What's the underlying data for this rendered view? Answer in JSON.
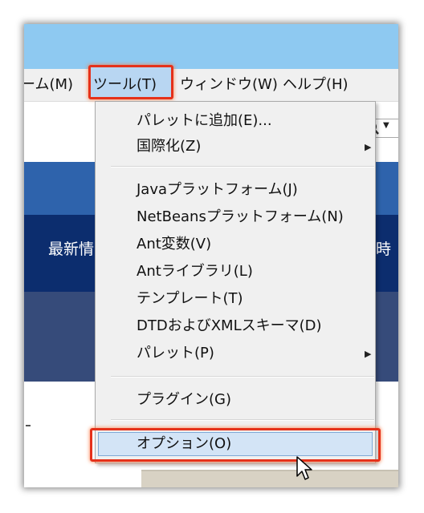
{
  "menubar": {
    "items": [
      {
        "label": "ーム(M)"
      },
      {
        "label": "ツール(T)"
      },
      {
        "label": "ウィンドウ(W)"
      },
      {
        "label": "ヘルプ(H)"
      }
    ],
    "search_icon": "magnifier-icon"
  },
  "background_page": {
    "nav_left": "最新情",
    "nav_right": "時"
  },
  "tools_menu": {
    "items": [
      {
        "label": "パレットに追加(E)...",
        "submenu": false
      },
      {
        "label": "国際化(Z)",
        "submenu": true
      },
      {
        "label": "Javaプラットフォーム(J)",
        "submenu": false
      },
      {
        "label": "NetBeansプラットフォーム(N)",
        "submenu": false
      },
      {
        "label": "Ant変数(V)",
        "submenu": false
      },
      {
        "label": "Antライブラリ(L)",
        "submenu": false
      },
      {
        "label": "テンプレート(T)",
        "submenu": false
      },
      {
        "label": "DTDおよびXMLスキーマ(D)",
        "submenu": false
      },
      {
        "label": "パレット(P)",
        "submenu": true
      },
      {
        "label": "プラグイン(G)",
        "submenu": false
      },
      {
        "label": "オプション(O)",
        "submenu": false,
        "highlighted": true
      }
    ],
    "submenu_arrow_icon": "triangle-right-icon"
  },
  "highlight_color": "#e5311a"
}
